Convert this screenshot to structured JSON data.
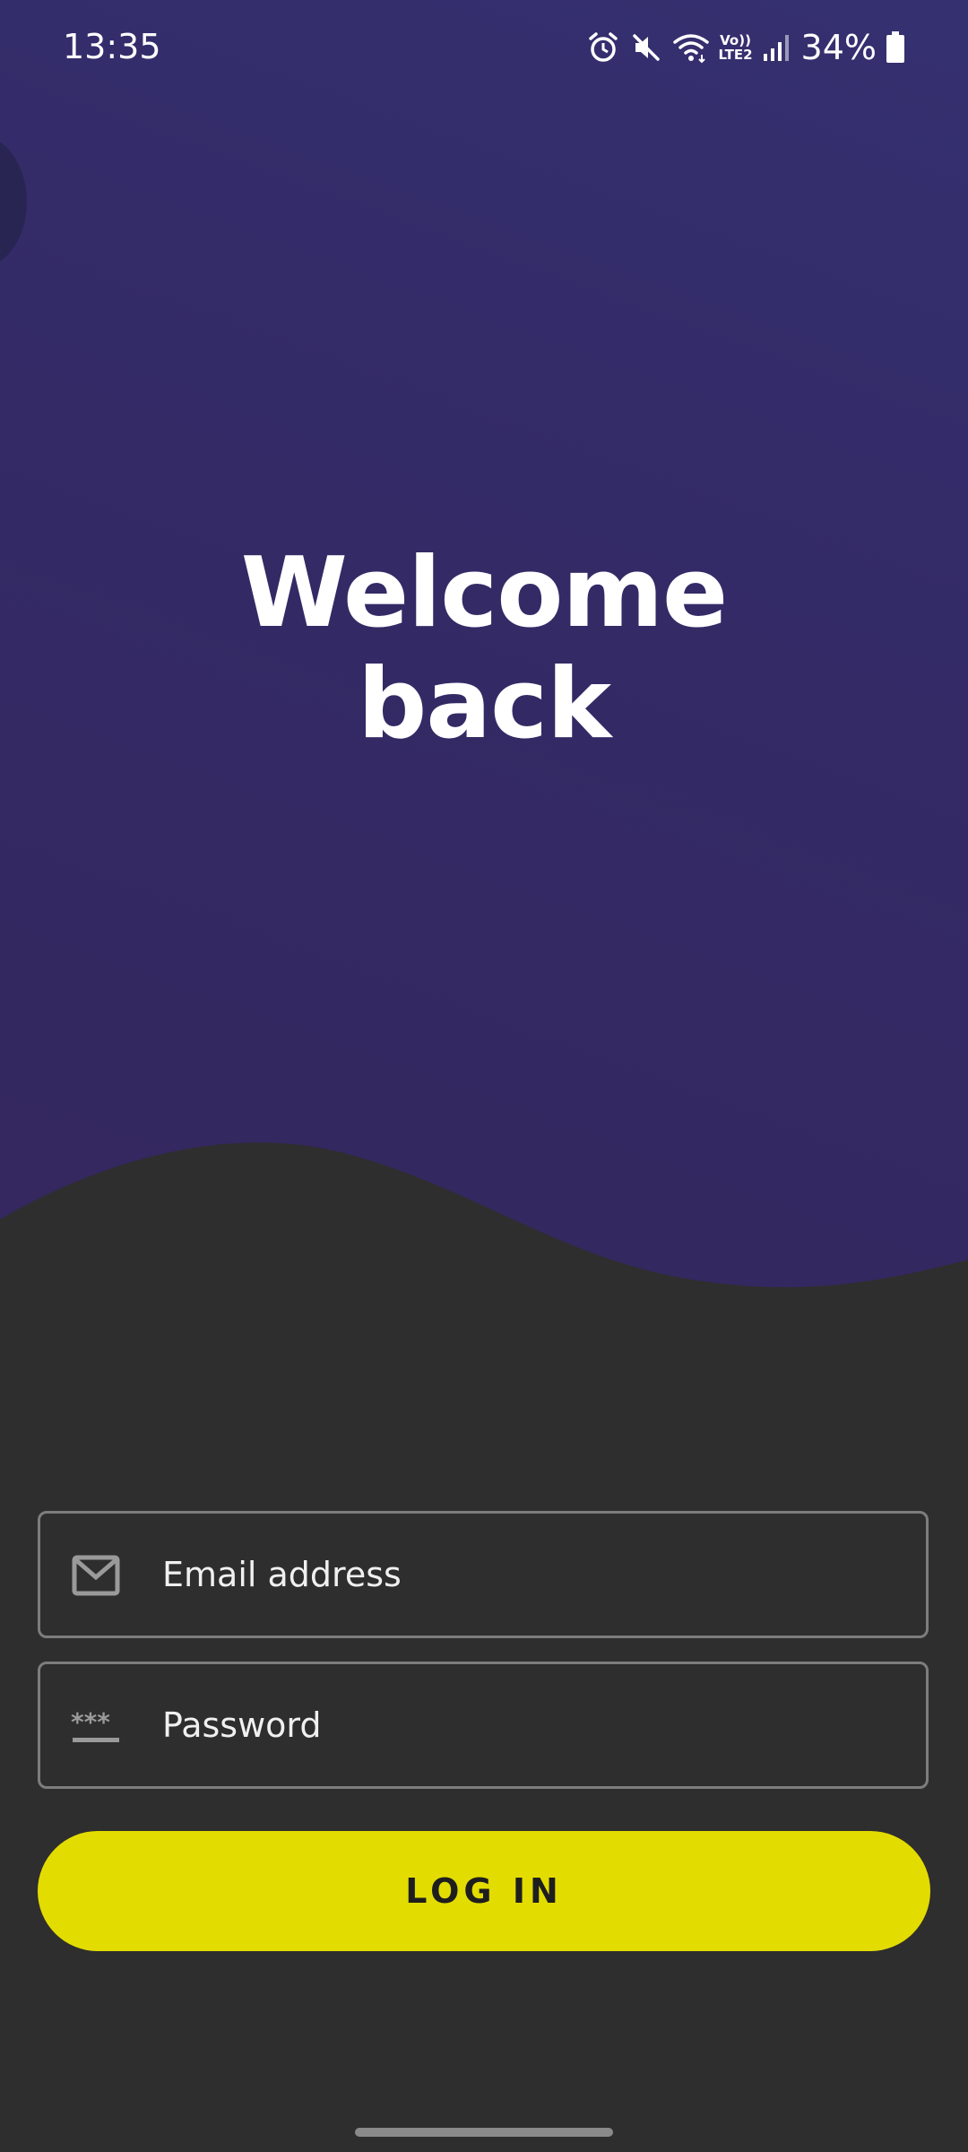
{
  "status_bar": {
    "time": "13:35",
    "network_label_top": "Vo))",
    "network_label_bottom": "LTE2",
    "battery_percent": "34%",
    "icons": [
      "alarm-icon",
      "mute-icon",
      "wifi-icon",
      "signal-icon",
      "battery-icon"
    ]
  },
  "hero": {
    "title_line1": "Welcome",
    "title_line2": "back"
  },
  "form": {
    "email_placeholder": "Email address",
    "password_placeholder": "Password",
    "login_label": "LOG IN"
  },
  "colors": {
    "hero_background": "#332b68",
    "page_background": "#2e2e2e",
    "button_accent": "#e3dc00",
    "field_border": "#7d7d7d"
  }
}
